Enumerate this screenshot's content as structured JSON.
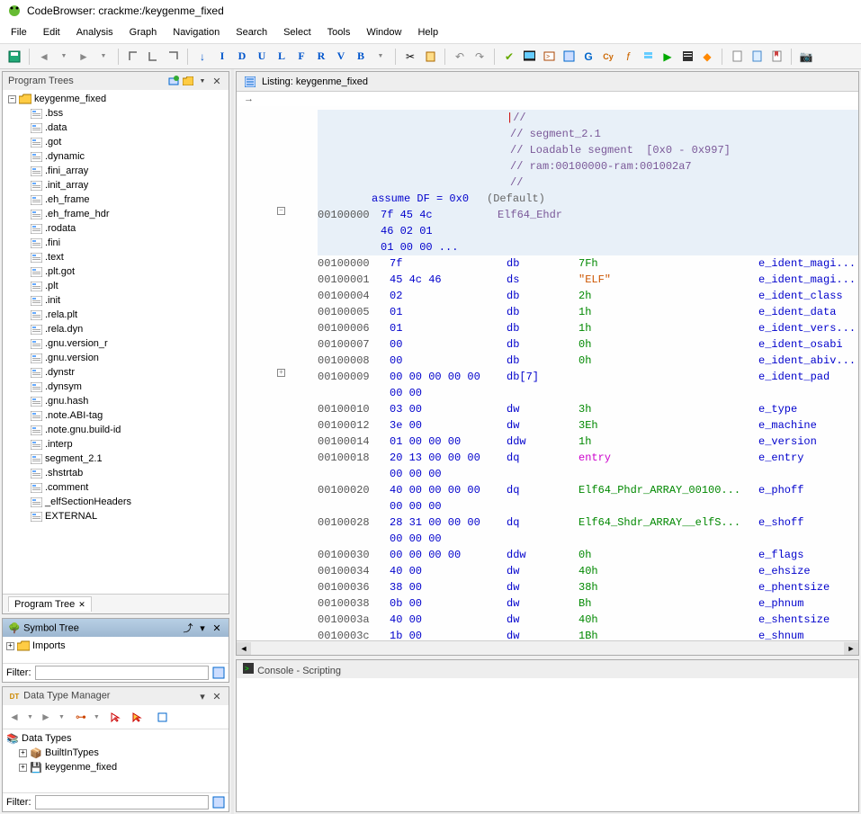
{
  "window_title": "CodeBrowser: crackme:/keygenme_fixed",
  "menus": [
    "File",
    "Edit",
    "Analysis",
    "Graph",
    "Navigation",
    "Search",
    "Select",
    "Tools",
    "Window",
    "Help"
  ],
  "program_trees": {
    "title": "Program Trees",
    "root": "keygenme_fixed",
    "items": [
      ".bss",
      ".data",
      ".got",
      ".dynamic",
      ".fini_array",
      ".init_array",
      ".eh_frame",
      ".eh_frame_hdr",
      ".rodata",
      ".fini",
      ".text",
      ".plt.got",
      ".plt",
      ".init",
      ".rela.plt",
      ".rela.dyn",
      ".gnu.version_r",
      ".gnu.version",
      ".dynstr",
      ".dynsym",
      ".gnu.hash",
      ".note.ABI-tag",
      ".note.gnu.build-id",
      ".interp",
      "segment_2.1",
      ".shstrtab",
      ".comment",
      "_elfSectionHeaders",
      "EXTERNAL"
    ],
    "tab": "Program Tree"
  },
  "symbol_tree": {
    "title": "Symbol Tree",
    "imports": "Imports",
    "filter_label": "Filter:"
  },
  "dt_manager": {
    "title": "Data Type Manager",
    "root": "Data Types",
    "items": [
      "BuiltInTypes",
      "keygenme_fixed"
    ],
    "filter_label": "Filter:"
  },
  "listing": {
    "title": "Listing: keygenme_fixed",
    "header_comments": [
      "//",
      "// segment_2.1",
      "// Loadable segment  [0x0 - 0x997]",
      "// ram:00100000-ram:001002a7",
      "//"
    ],
    "assume": "assume DF = 0x0",
    "default": "(Default)",
    "struct_addr": "00100000",
    "struct_bytes": [
      "7f 45 4c",
      "46 02 01",
      "01 00 00 ..."
    ],
    "struct_name": "Elf64_Ehdr",
    "rows": [
      {
        "a": "00100000",
        "b": "7f",
        "m": "db",
        "o": "7Fh",
        "oc": "lbl",
        "f": "e_ident_magi..."
      },
      {
        "a": "00100001",
        "b": "45 4c 46",
        "m": "ds",
        "o": "\"ELF\"",
        "oc": "str",
        "f": "e_ident_magi..."
      },
      {
        "a": "00100004",
        "b": "02",
        "m": "db",
        "o": "2h",
        "oc": "lbl",
        "f": "e_ident_class"
      },
      {
        "a": "00100005",
        "b": "01",
        "m": "db",
        "o": "1h",
        "oc": "lbl",
        "f": "e_ident_data"
      },
      {
        "a": "00100006",
        "b": "01",
        "m": "db",
        "o": "1h",
        "oc": "lbl",
        "f": "e_ident_vers..."
      },
      {
        "a": "00100007",
        "b": "00",
        "m": "db",
        "o": "0h",
        "oc": "lbl",
        "f": "e_ident_osabi"
      },
      {
        "a": "00100008",
        "b": "00",
        "m": "db",
        "o": "0h",
        "oc": "lbl",
        "f": "e_ident_abiv..."
      },
      {
        "a": "00100009",
        "b": "00 00 00 00 00",
        "m": "db[7]",
        "o": "",
        "oc": "",
        "f": "e_ident_pad",
        "exp": true
      },
      {
        "a": "",
        "b": "00 00",
        "m": "",
        "o": "",
        "oc": "",
        "f": ""
      },
      {
        "a": "00100010",
        "b": "03 00",
        "m": "dw",
        "o": "3h",
        "oc": "lbl",
        "f": "e_type"
      },
      {
        "a": "00100012",
        "b": "3e 00",
        "m": "dw",
        "o": "3Eh",
        "oc": "lbl",
        "f": "e_machine"
      },
      {
        "a": "00100014",
        "b": "01 00 00 00",
        "m": "ddw",
        "o": "1h",
        "oc": "lbl",
        "f": "e_version"
      },
      {
        "a": "00100018",
        "b": "20 13 00 00 00",
        "m": "dq",
        "o": "entry",
        "oc": "ref",
        "f": "e_entry"
      },
      {
        "a": "",
        "b": "00 00 00",
        "m": "",
        "o": "",
        "oc": "",
        "f": ""
      },
      {
        "a": "00100020",
        "b": "40 00 00 00 00",
        "m": "dq",
        "o": "Elf64_Phdr_ARRAY_00100...",
        "oc": "lbl",
        "f": "e_phoff"
      },
      {
        "a": "",
        "b": "00 00 00",
        "m": "",
        "o": "",
        "oc": "",
        "f": ""
      },
      {
        "a": "00100028",
        "b": "28 31 00 00 00",
        "m": "dq",
        "o": "Elf64_Shdr_ARRAY__elfS...",
        "oc": "lbl",
        "f": "e_shoff"
      },
      {
        "a": "",
        "b": "00 00 00",
        "m": "",
        "o": "",
        "oc": "",
        "f": ""
      },
      {
        "a": "00100030",
        "b": "00 00 00 00",
        "m": "ddw",
        "o": "0h",
        "oc": "lbl",
        "f": "e_flags"
      },
      {
        "a": "00100034",
        "b": "40 00",
        "m": "dw",
        "o": "40h",
        "oc": "lbl",
        "f": "e_ehsize"
      },
      {
        "a": "00100036",
        "b": "38 00",
        "m": "dw",
        "o": "38h",
        "oc": "lbl",
        "f": "e_phentsize"
      },
      {
        "a": "00100038",
        "b": "0b 00",
        "m": "dw",
        "o": "Bh",
        "oc": "lbl",
        "f": "e_phnum"
      },
      {
        "a": "0010003a",
        "b": "40 00",
        "m": "dw",
        "o": "40h",
        "oc": "lbl",
        "f": "e_shentsize"
      },
      {
        "a": "0010003c",
        "b": "1b 00",
        "m": "dw",
        "o": "1Bh",
        "oc": "lbl",
        "f": "e_shnum"
      }
    ]
  },
  "console_title": "Console - Scripting"
}
